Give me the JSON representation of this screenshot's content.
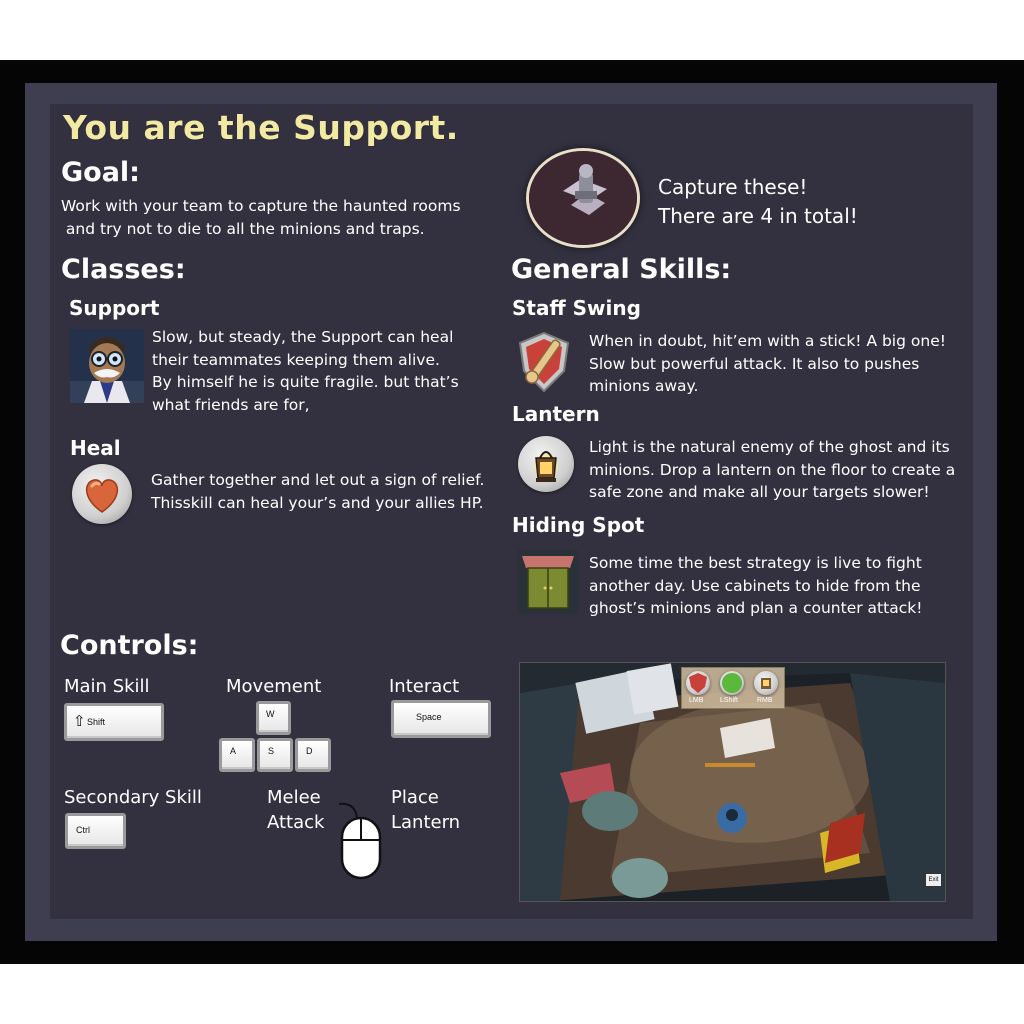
{
  "title": "You are the Support.",
  "goal": {
    "heading": "Goal:",
    "text_line1": "Work with your team to capture the haunted rooms",
    "text_line2": " and try not to die to all the minions and traps."
  },
  "capture": {
    "line1": "Capture these!",
    "line2": "There are 4 in total!"
  },
  "classes": {
    "heading": "Classes:",
    "support": {
      "name": "Support",
      "lines": [
        "Slow, but steady, the Support can heal",
        "their teammates keeping them alive.",
        "By himself he is quite fragile. but that’s",
        "what friends are for,"
      ]
    },
    "heal": {
      "name": "Heal",
      "lines": [
        "Gather together and let out a sign of relief.",
        "Thisskill can heal your’s and your allies HP."
      ]
    }
  },
  "general_skills": {
    "heading": "General Skills:",
    "staff_swing": {
      "name": "Staff Swing",
      "lines": [
        "When in doubt, hit’em with a stick! A big one!",
        "Slow but powerful attack. It also to pushes",
        "minions away."
      ]
    },
    "lantern": {
      "name": "Lantern",
      "lines": [
        "Light is the natural enemy of the ghost and its",
        "minions. Drop a lantern on the floor to create a",
        "safe zone and make all your targets slower!"
      ]
    },
    "hiding_spot": {
      "name": "Hiding Spot",
      "lines": [
        "Some time the best strategy is live to fight",
        "another day. Use cabinets to hide from the",
        "ghost’s minions and plan a counter attack!"
      ]
    }
  },
  "controls": {
    "heading": "Controls:",
    "main_skill": "Main Skill",
    "movement": "Movement",
    "interact": "Interact",
    "secondary_skill": "Secondary Skill",
    "melee_line1": "Melee",
    "melee_line2": "Attack",
    "place_line1": "Place",
    "place_line2": "Lantern",
    "keys": {
      "shift_arrow": "⇧",
      "shift": "Shift",
      "w": "W",
      "a": "A",
      "s": "S",
      "d": "D",
      "space": "Space",
      "ctrl": "Ctrl"
    }
  },
  "game_hud": {
    "lmb": "LMB",
    "lshift": "LShift",
    "rmb": "RMB",
    "exit": "Exit"
  },
  "colors": {
    "title": "#f2e9a2",
    "panel_outer": "#3f3e50",
    "panel_inner": "#33313f",
    "frame": "#050505"
  },
  "icons": {
    "capture": "capture-point-icon",
    "support_portrait": "support-portrait",
    "heal": "heart-icon",
    "staff_swing": "shield-staff-icon",
    "lantern": "lantern-icon",
    "hiding_spot": "cabinet-icon",
    "mouse": "mouse-icon"
  }
}
